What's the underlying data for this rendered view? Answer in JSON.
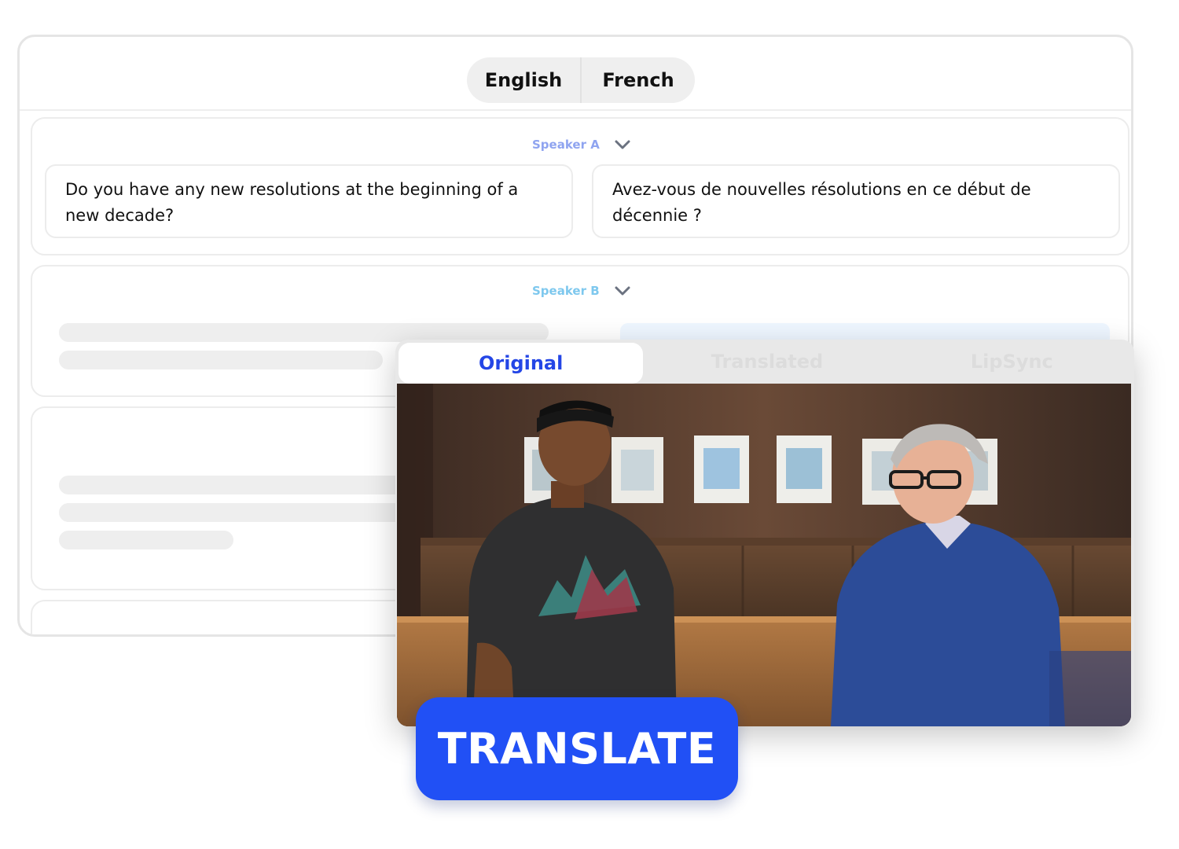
{
  "languages": [
    "English",
    "French"
  ],
  "segments": [
    {
      "speaker": "Speaker A",
      "source_text": "Do you have any new resolutions at the beginning of a new decade?",
      "translated_text": "Avez-vous de nouvelles résolutions en ce début de décennie ?"
    },
    {
      "speaker": "Speaker B"
    }
  ],
  "player": {
    "tabs": [
      "Original",
      "Translated",
      "LipSync"
    ],
    "active_tab": "Original"
  },
  "actions": {
    "translate_label": "TRANSLATE"
  },
  "colors": {
    "accent": "#2150f5",
    "active_tab_text": "#2446e6",
    "speaker_a": "#8fa4f0",
    "speaker_b": "#7ec8ee"
  },
  "icons": [
    "chevron-down-icon"
  ]
}
